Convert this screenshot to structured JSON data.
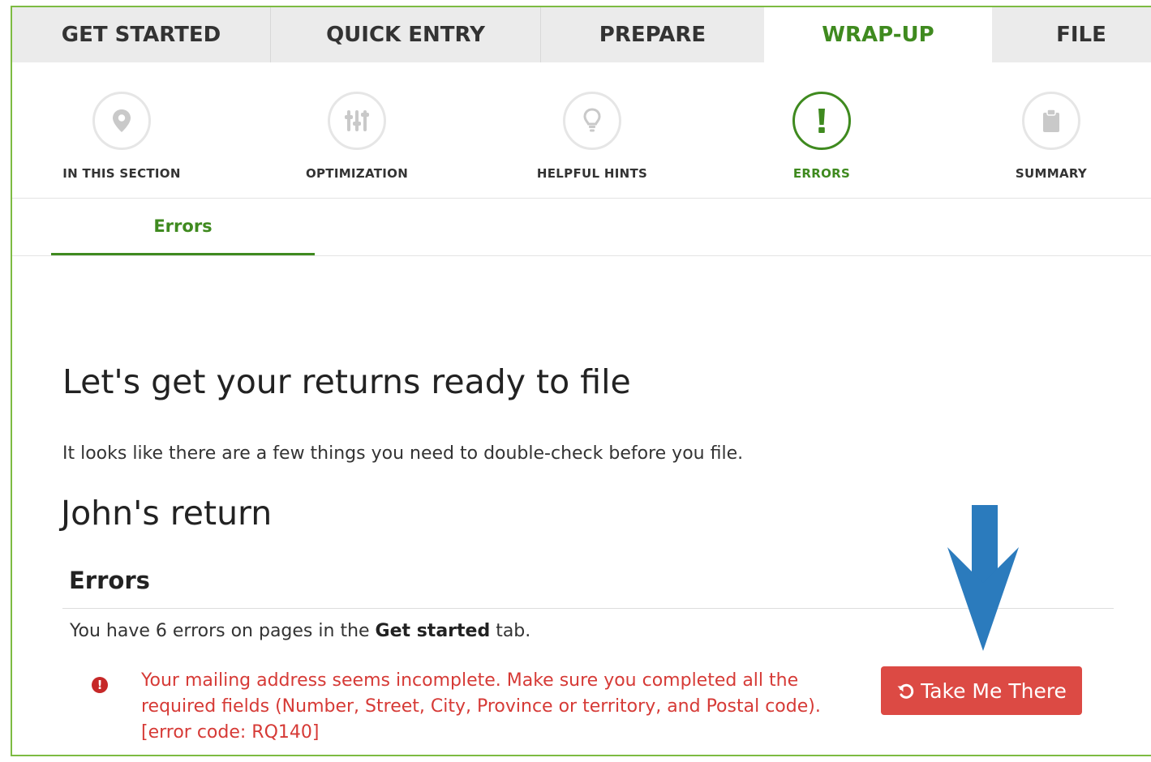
{
  "tabs": [
    {
      "label": "GET STARTED"
    },
    {
      "label": "QUICK ENTRY"
    },
    {
      "label": "PREPARE"
    },
    {
      "label": "WRAP-UP"
    },
    {
      "label": "FILE"
    }
  ],
  "active_tab": "WRAP-UP",
  "steps": [
    {
      "label": "IN THIS SECTION",
      "icon": "map-pin-icon"
    },
    {
      "label": "OPTIMIZATION",
      "icon": "sliders-icon"
    },
    {
      "label": "HELPFUL HINTS",
      "icon": "lightbulb-icon"
    },
    {
      "label": "ERRORS",
      "icon": "exclamation-icon"
    },
    {
      "label": "SUMMARY",
      "icon": "clipboard-icon"
    }
  ],
  "active_step": "ERRORS",
  "subtab": {
    "label": "Errors"
  },
  "content": {
    "heading": "Let's get your returns ready to file",
    "intro": "It looks like there are a few things you need to double-check before you file.",
    "return_title": "John's return",
    "errors_heading": "Errors",
    "errors_count": {
      "before": "You have 6 errors on pages in the ",
      "tab": "Get started",
      "after": " tab."
    },
    "error": {
      "icon": "!",
      "message": "Your mailing address seems incomplete. Make sure you completed all the required fields (Number, Street, City, Province or territory, and Postal code). [error code: RQ140]"
    },
    "button": {
      "label": "Take Me There",
      "icon": "undo-icon"
    }
  },
  "annotation": {
    "icon": "down-arrow-icon",
    "color": "#2b7bbd"
  },
  "colors": {
    "accent_green": "#3f8a1f",
    "frame_green": "#7dbb42",
    "error_red": "#d63a36",
    "button_red": "#dc4a44",
    "tab_gray": "#ebebeb"
  }
}
